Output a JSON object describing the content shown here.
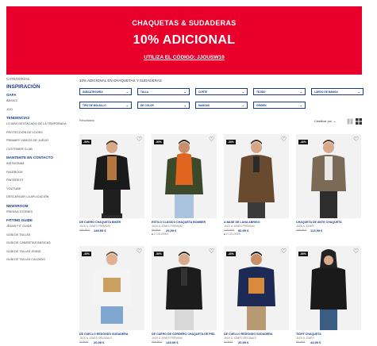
{
  "banner": {
    "line1": "CHAQUETAS & SUDADERAS",
    "line2": "10% ADICIONAL",
    "line3": "UTILIZA EL CÓDIGO: JJOUSW10"
  },
  "sidebar": {
    "title": "CATEGORÍAS",
    "inspiracion": "INSPIRACIÓN",
    "gafas": "GAFA",
    "gafas_items": [
      "BÁSICS",
      "JOG"
    ],
    "tendencias": "TENDENCIAS",
    "tendencias_items": [
      "LO MÁS DESTACADO DE LA TEMPORADA",
      "PROTECCIÓN DE LOOKS",
      "PRIMARY VIDEOS DE JUEGO",
      "CUSTOMER CLUB"
    ],
    "contacto": "MANTENTE EN CONTACTO",
    "contacto_items": [
      "INSTAGRAM",
      "FACEBOOK",
      "PINTEREST",
      "YOUTUBE",
      "DESCARGAR LA APLICACIÓN"
    ],
    "newsroom": "NEWSROOM",
    "newsroom_items": [
      "PRENSA STORIES"
    ],
    "fitting": "FITTING GUIDE",
    "fitting_items": [
      "JEANS FIT GUIDE",
      "GUÍA DE TALLAS",
      "GUÍA DE CAMISETAS BÁSICAS",
      "GUÍA DE TALLAS JEANS",
      "GUÍA DE TALLAS CALZADO"
    ]
  },
  "breadcrumb": "10% ADICIONAL EN CHAQUETAS Y SUDADERAS",
  "filters": [
    "SUBCATEGORÍA",
    "TALLA",
    "CORTE",
    "TEJIDO",
    "LARGO DE MANGA",
    "TIPO DE BOLSILLO",
    "DE COLOR",
    "MANGAS",
    "ORIGEN"
  ],
  "results_label": "Resultados",
  "sort_label": "Clasificar por",
  "products": [
    {
      "badge": "-50%",
      "name": "DE CUERO CHAQUETA BIKER",
      "brand": "JACK & JONES PREMIUM",
      "old": "299,99 €",
      "new": "149,99 €",
      "colors": ""
    },
    {
      "badge": "-50%",
      "name": "ESTILO CLÁSICO CHAQUETA BOMBER",
      "brand": "JACK & JONES PREMIUM",
      "old": "59,99 €",
      "new": "29,99 €",
      "colors": "■ 2 COLORES"
    },
    {
      "badge": "-30%",
      "name": "A BASE DE LANA ABRIGO",
      "brand": "JACK & JONES PREMIUM",
      "old": "129,99 €",
      "new": "90,99 €",
      "colors": "■ 2 COLORES"
    },
    {
      "badge": "-40%",
      "name": "CHAQUETA DE ANTE CHAQUETA",
      "brand": "JACK & JONES",
      "old": "189,99 €",
      "new": "113,99 €",
      "colors": ""
    },
    {
      "badge": "-40%",
      "name": "DE CUELLO REDONDO SUDADERA",
      "brand": "JACK & JONES ORIGINALS",
      "old": "34,99 €",
      "new": "20,99 €",
      "colors": ""
    },
    {
      "badge": "-50%",
      "name": "DE CUERO DE CORDERO CHAQUETA DE PIEL",
      "brand": "JACK & JONES PREMIUM",
      "old": "299,99 €",
      "new": "149,99 €",
      "colors": ""
    },
    {
      "badge": "-40%",
      "name": "DE CUELLO REDONDO SUDADERA",
      "brand": "JACK & JONES ORIGINALS",
      "old": "34,99 €",
      "new": "20,99 €",
      "colors": ""
    },
    {
      "badge": "-50%",
      "name": "TIGHT CHAQUETA",
      "brand": "JACK & JONES",
      "old": "89,99 €",
      "new": "44,99 €",
      "colors": ""
    }
  ]
}
